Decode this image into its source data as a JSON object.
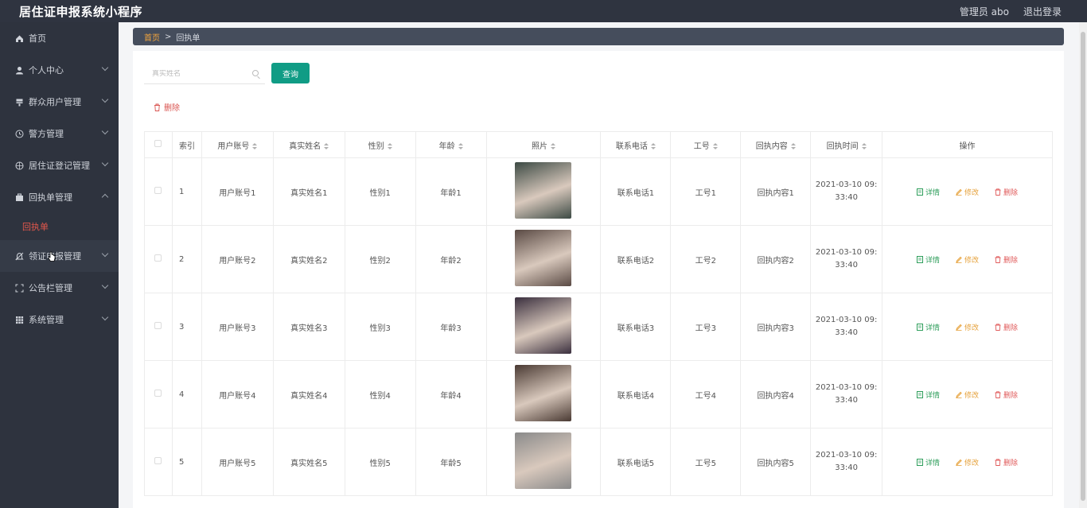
{
  "app": {
    "title": "居住证申报系统小程序"
  },
  "header": {
    "admin_label": "管理员 abo",
    "logout_label": "退出登录"
  },
  "sidebar": {
    "items": [
      {
        "label": "首页",
        "icon": "home-icon"
      },
      {
        "label": "个人中心",
        "icon": "user-icon"
      },
      {
        "label": "群众用户管理",
        "icon": "users-icon"
      },
      {
        "label": "警方管理",
        "icon": "clock-icon"
      },
      {
        "label": "居住证登记管理",
        "icon": "compass-icon"
      },
      {
        "label": "回执单管理",
        "icon": "briefcase-icon",
        "expanded": true
      },
      {
        "label": "领证申报管理",
        "icon": "bell-icon"
      },
      {
        "label": "公告栏管理",
        "icon": "frame-icon"
      },
      {
        "label": "系统管理",
        "icon": "grid-icon"
      }
    ],
    "sub_item": "回执单"
  },
  "breadcrumb": {
    "home": "首页",
    "separator": ">",
    "current": "回执单"
  },
  "search": {
    "placeholder": "真实姓名",
    "query_label": "查询"
  },
  "toolbar": {
    "delete_label": "删除"
  },
  "table": {
    "headers": [
      "索引",
      "用户账号",
      "真实姓名",
      "性别",
      "年龄",
      "照片",
      "联系电话",
      "工号",
      "回执内容",
      "回执时间",
      "操作"
    ],
    "action_labels": {
      "detail": "详情",
      "edit": "修改",
      "remove": "删除"
    },
    "rows": [
      {
        "index": "1",
        "account": "用户账号1",
        "name": "真实姓名1",
        "gender": "性别1",
        "age": "年龄1",
        "phone": "联系电话1",
        "job_no": "工号1",
        "content": "回执内容1",
        "time_a": "2021-03-10 09:",
        "time_b": "33:40",
        "photo_color": "#3c4a44"
      },
      {
        "index": "2",
        "account": "用户账号2",
        "name": "真实姓名2",
        "gender": "性别2",
        "age": "年龄2",
        "phone": "联系电话2",
        "job_no": "工号2",
        "content": "回执内容2",
        "time_a": "2021-03-10 09:",
        "time_b": "33:40",
        "photo_color": "#5a4a44"
      },
      {
        "index": "3",
        "account": "用户账号3",
        "name": "真实姓名3",
        "gender": "性别3",
        "age": "年龄3",
        "phone": "联系电话3",
        "job_no": "工号3",
        "content": "回执内容3",
        "time_a": "2021-03-10 09:",
        "time_b": "33:40",
        "photo_color": "#3a2f3e"
      },
      {
        "index": "4",
        "account": "用户账号4",
        "name": "真实姓名4",
        "gender": "性别4",
        "age": "年龄4",
        "phone": "联系电话4",
        "job_no": "工号4",
        "content": "回执内容4",
        "time_a": "2021-03-10 09:",
        "time_b": "33:40",
        "photo_color": "#4a3a33"
      },
      {
        "index": "5",
        "account": "用户账号5",
        "name": "真实姓名5",
        "gender": "性别5",
        "age": "年龄5",
        "phone": "联系电话5",
        "job_no": "工号5",
        "content": "回执内容5",
        "time_a": "2021-03-10 09:",
        "time_b": "33:40",
        "photo_color": "#8a8a8a"
      }
    ]
  },
  "colors": {
    "accent": "#109c85",
    "sidebar_bg": "#2e333e",
    "topbar_bg": "#2f3440",
    "danger": "#e05a5a",
    "warning": "#e6a23c",
    "success": "#2e9e5b"
  }
}
